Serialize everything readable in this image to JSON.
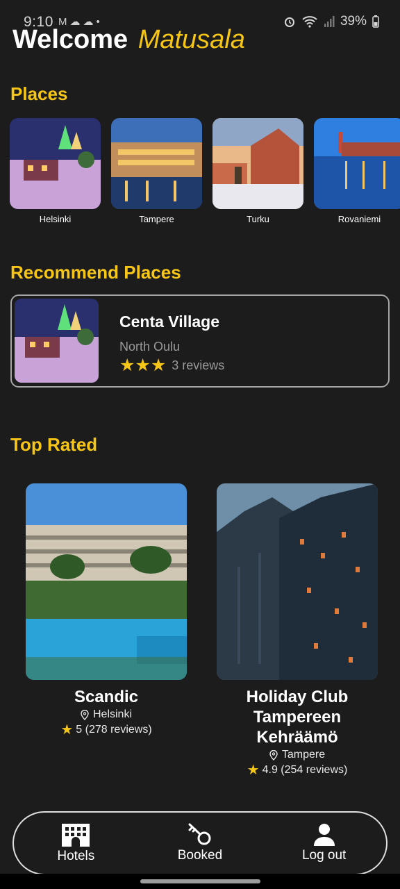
{
  "status_bar": {
    "time": "9:10",
    "left_icons": [
      "mail-icon",
      "cloud-icon",
      "cloud-alt-icon",
      "dot-icon"
    ],
    "battery": "39%"
  },
  "header": {
    "welcome": "Welcome",
    "username": "Matusala"
  },
  "places": {
    "title": "Places",
    "items": [
      {
        "label": "Helsinki"
      },
      {
        "label": "Tampere"
      },
      {
        "label": "Turku"
      },
      {
        "label": "Rovaniemi"
      }
    ]
  },
  "recommend": {
    "title": "Recommend Places",
    "card": {
      "name": "Centa Village",
      "location": "North Oulu",
      "stars": 3,
      "reviews": "3 reviews"
    }
  },
  "top_rated": {
    "title": "Top Rated",
    "hotels": [
      {
        "name": "Scandic",
        "location": "Helsinki",
        "rating": "5 (278 reviews)"
      },
      {
        "name": "Holiday Club Tampereen Kehräämö",
        "location": "Tampere",
        "rating": "4.9 (254 reviews)"
      }
    ]
  },
  "nav": {
    "items": [
      {
        "label": "Hotels",
        "icon": "hotel-icon"
      },
      {
        "label": "Booked",
        "icon": "key-icon"
      },
      {
        "label": "Log out",
        "icon": "person-icon"
      }
    ]
  },
  "colors": {
    "accent": "#f5c518",
    "background": "#1c1c1c",
    "muted_text": "#9a9a9a"
  }
}
